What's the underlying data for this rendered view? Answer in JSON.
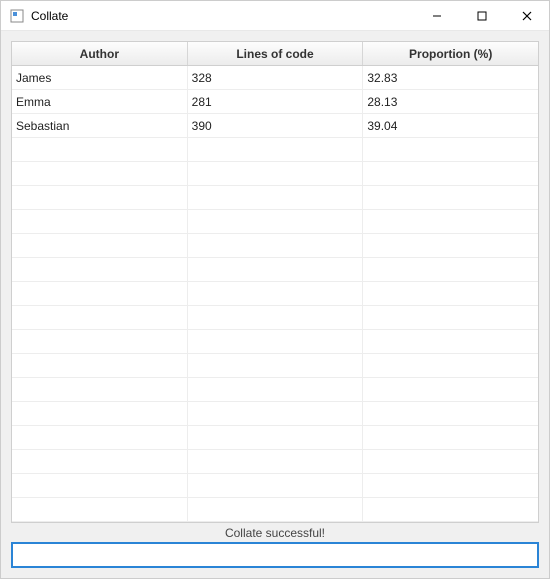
{
  "window": {
    "title": "Collate"
  },
  "table": {
    "headers": [
      "Author",
      "Lines of code",
      "Proportion (%)"
    ],
    "rows": [
      {
        "author": "James",
        "lines": "328",
        "proportion": "32.83"
      },
      {
        "author": "Emma",
        "lines": "281",
        "proportion": "28.13"
      },
      {
        "author": "Sebastian",
        "lines": "390",
        "proportion": "39.04"
      }
    ],
    "empty_row_count": 16
  },
  "status": {
    "message": "Collate successful!"
  },
  "input": {
    "value": "",
    "placeholder": ""
  }
}
